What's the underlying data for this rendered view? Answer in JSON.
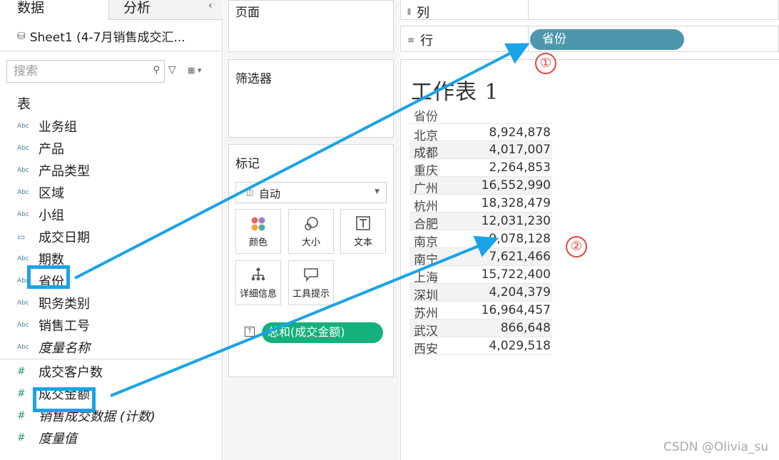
{
  "left_pane": {
    "tabs": [
      {
        "label": "数据"
      },
      {
        "label": "分析"
      }
    ],
    "collapse_glyph": "‹",
    "datasource": "Sheet1 (4-7月销售成交汇...",
    "search_placeholder": "搜索",
    "table_heading": "表",
    "dimensions": [
      {
        "type": "Abc",
        "name": "业务组"
      },
      {
        "type": "Abc",
        "name": "产品"
      },
      {
        "type": "Abc",
        "name": "产品类型"
      },
      {
        "type": "Abc",
        "name": "区域"
      },
      {
        "type": "Abc",
        "name": "小组"
      },
      {
        "type": "calendar",
        "name": "成交日期"
      },
      {
        "type": "Abc",
        "name": "期数"
      },
      {
        "type": "Abc",
        "name": "省份"
      },
      {
        "type": "Abc",
        "name": "职务类别"
      },
      {
        "type": "Abc",
        "name": "销售工号"
      },
      {
        "type": "Abc",
        "name": "度量名称"
      }
    ],
    "measures": [
      {
        "type": "#",
        "name": "成交客户数"
      },
      {
        "type": "#",
        "name": "成交金额"
      },
      {
        "type": "#",
        "name": "销售成交数据 (计数)"
      },
      {
        "type": "#",
        "name": "度量值"
      }
    ]
  },
  "middle": {
    "pages_title": "页面",
    "filters_title": "筛选器",
    "marks_title": "标记",
    "mark_type": "自动",
    "mark_buttons": [
      {
        "label": "颜色",
        "icon": "color-icon"
      },
      {
        "label": "大小",
        "icon": "size-icon"
      },
      {
        "label": "文本",
        "icon": "text-icon"
      },
      {
        "label": "详细信息",
        "icon": "detail-icon"
      },
      {
        "label": "工具提示",
        "icon": "tooltip-icon"
      }
    ],
    "text_pill": "总和(成交金额)"
  },
  "shelves": {
    "columns_label": "列",
    "rows_label": "行",
    "rows_pill": "省份"
  },
  "view": {
    "sheet_title": "工作表 1",
    "column_header": "省份",
    "rows": [
      {
        "province": "北京",
        "amount": "8,924,878"
      },
      {
        "province": "成都",
        "amount": "4,017,007"
      },
      {
        "province": "重庆",
        "amount": "2,264,853"
      },
      {
        "province": "广州",
        "amount": "16,552,990"
      },
      {
        "province": "杭州",
        "amount": "18,328,479"
      },
      {
        "province": "合肥",
        "amount": "12,031,230"
      },
      {
        "province": "南京",
        "amount": "9,078,128"
      },
      {
        "province": "南宁",
        "amount": "7,621,466"
      },
      {
        "province": "上海",
        "amount": "15,722,400"
      },
      {
        "province": "深圳",
        "amount": "4,204,379"
      },
      {
        "province": "苏州",
        "amount": "16,964,457"
      },
      {
        "province": "武汉",
        "amount": "866,648"
      },
      {
        "province": "西安",
        "amount": "4,029,518"
      }
    ]
  },
  "annotations": {
    "step1": "①",
    "step2": "②",
    "arrow_color": "#1aa3e8",
    "step_color": "#e5443e"
  },
  "watermark": "CSDN @Olivia_su"
}
